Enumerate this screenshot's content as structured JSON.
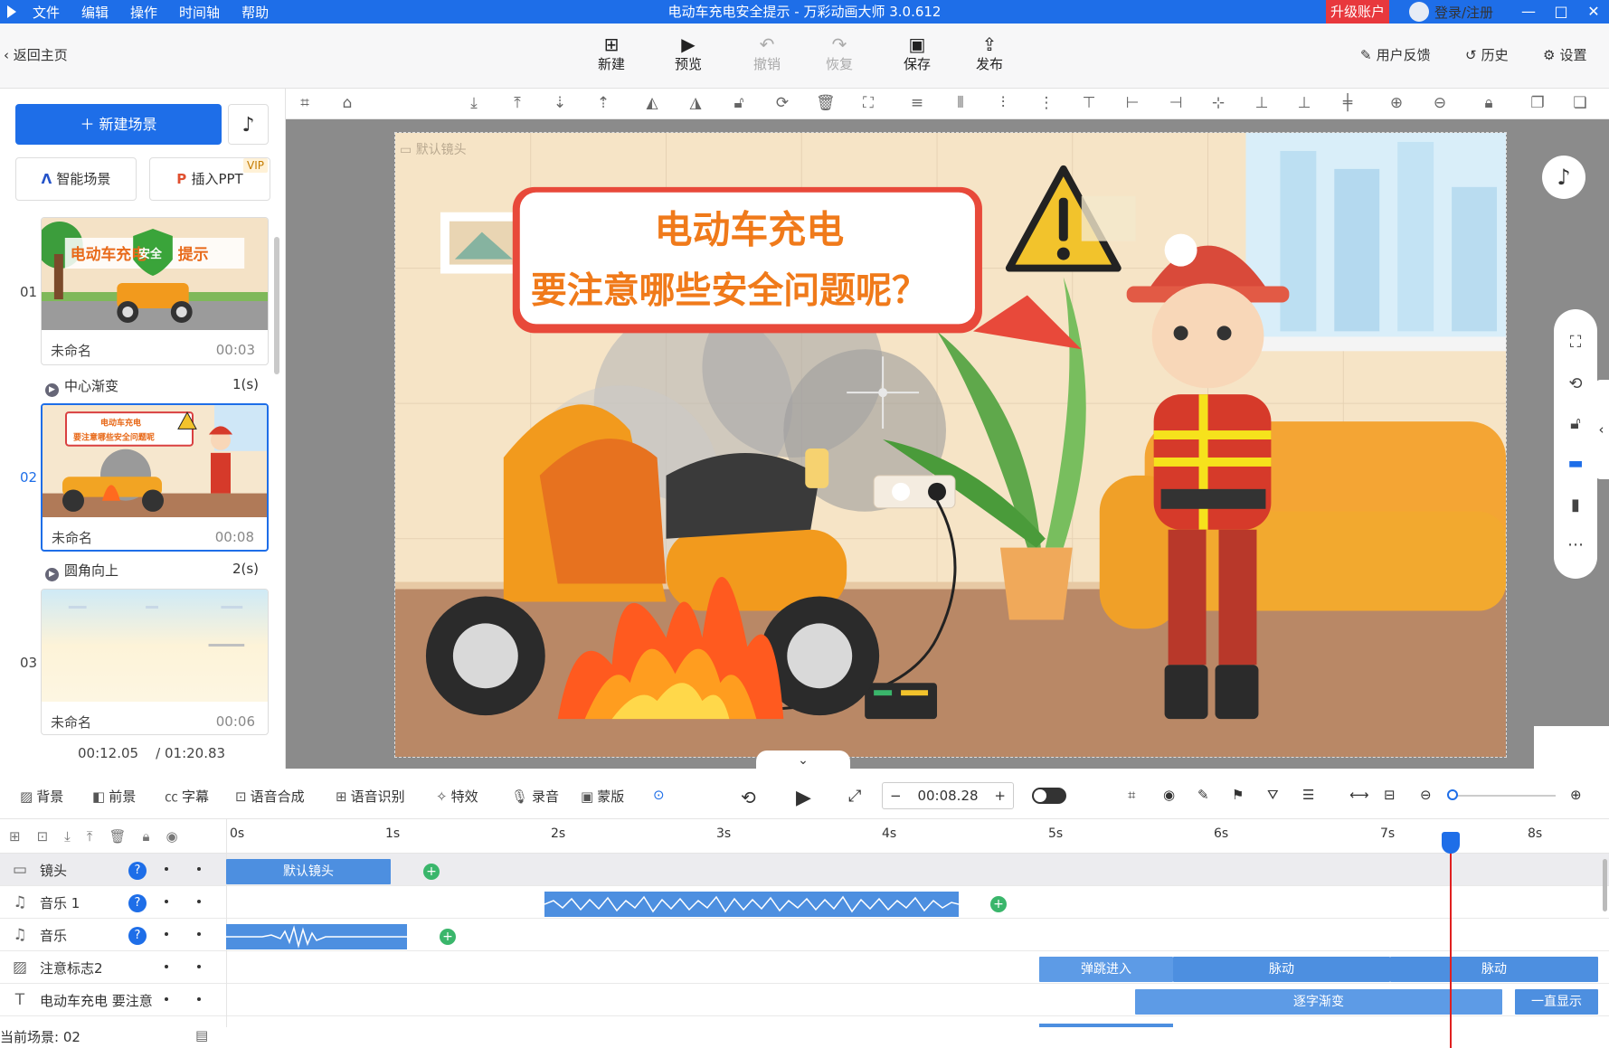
{
  "titlebar": {
    "menu": [
      "文件",
      "编辑",
      "操作",
      "时间轴",
      "帮助"
    ],
    "title": "电动车充电安全提示 - 万彩动画大师 3.0.612",
    "upgrade": "升级账户",
    "login": "登录/注册",
    "brand_color": "#1e6ee8"
  },
  "toolbar": {
    "back": "返回主页",
    "buttons": [
      {
        "label": "新建",
        "icon": "new-icon"
      },
      {
        "label": "预览",
        "icon": "play-icon"
      },
      {
        "label": "撤销",
        "icon": "undo-icon"
      },
      {
        "label": "恢复",
        "icon": "redo-icon"
      },
      {
        "label": "保存",
        "icon": "save-icon"
      },
      {
        "label": "发布",
        "icon": "publish-icon"
      }
    ],
    "right": [
      {
        "label": "用户反馈",
        "icon": "feedback-icon"
      },
      {
        "label": "历史",
        "icon": "history-icon"
      },
      {
        "label": "设置",
        "icon": "settings-icon"
      }
    ]
  },
  "left": {
    "new_scene": "新建场景",
    "smart_scene": "智能场景",
    "insert_ppt": "插入PPT",
    "vip": "VIP",
    "scenes": [
      {
        "num": "01",
        "name": "未命名",
        "time": "00:03",
        "transition": "中心渐变",
        "trans_time": "1(s)"
      },
      {
        "num": "02",
        "name": "未命名",
        "time": "00:08",
        "transition": "圆角向上",
        "trans_time": "2(s)"
      },
      {
        "num": "03",
        "name": "未命名",
        "time": "00:06"
      }
    ],
    "current_time": "00:12.05",
    "total_time": "/ 01:20.83"
  },
  "canvas": {
    "camera_label": "默认镜头",
    "headline_1": "电动车充电",
    "headline_2": "要注意哪些安全问题呢？",
    "thumb1_title": "电动车充电",
    "thumb1_badge": "安全",
    "thumb1_tail": "提示",
    "thumb2_line1": "电动车充电",
    "thumb2_line2": "要注意哪些安全问题呢"
  },
  "bottombar": {
    "items": [
      "背景",
      "前景",
      "字幕",
      "语音合成",
      "语音识别",
      "特效",
      "录音",
      "蒙版"
    ],
    "time": "00:08.28"
  },
  "timeline": {
    "ticks": [
      "0s",
      "1s",
      "2s",
      "3s",
      "4s",
      "5s",
      "6s",
      "7s",
      "8s"
    ],
    "tracks": [
      {
        "name": "镜头",
        "help": "?"
      },
      {
        "name": "音乐 1",
        "help": "?"
      },
      {
        "name": "音乐",
        "help": "?"
      },
      {
        "name": "注意标志2"
      },
      {
        "name": "电动车充电 要注意"
      }
    ],
    "segments": {
      "camera": "默认镜头",
      "bounce_in": "弹跳进入",
      "pulse1": "脉动",
      "pulse2": "脉动",
      "fade_char": "逐字渐变",
      "always_show": "一直显示"
    },
    "status": "当前场景: 02"
  }
}
